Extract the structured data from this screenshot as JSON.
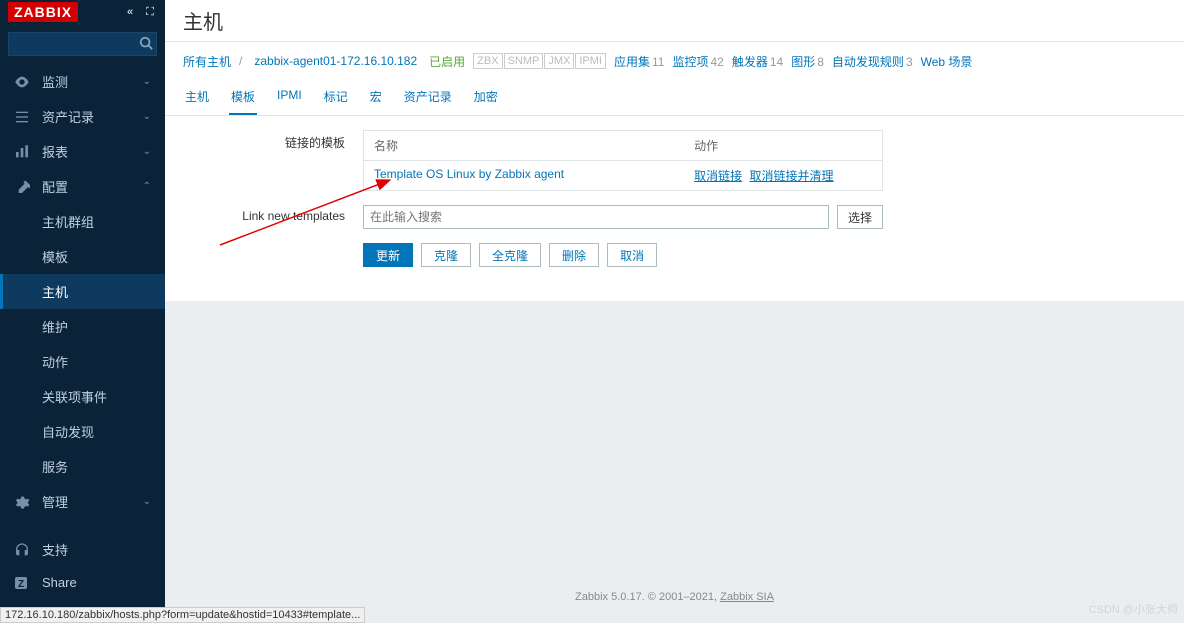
{
  "logo": "ZABBIX",
  "search": {
    "placeholder": ""
  },
  "nav": {
    "monitoring": "监测",
    "inventory": "资产记录",
    "reports": "报表",
    "configuration": "配置",
    "administration": "管理",
    "support": "支持",
    "share": "Share"
  },
  "subnav": {
    "hostGroups": "主机群组",
    "templates": "模板",
    "hosts": "主机",
    "maintenance": "维护",
    "actions": "动作",
    "eventCorrelation": "关联项事件",
    "discovery": "自动发现",
    "services": "服务"
  },
  "pageTitle": "主机",
  "breadcrumb": {
    "allHosts": "所有主机",
    "hostName": "zabbix-agent01-172.16.10.182",
    "enabled": "已启用",
    "zbx": "ZBX",
    "snmp": "SNMP",
    "jmx": "JMX",
    "ipmi": "IPMI",
    "applications": "应用集",
    "applicationsCount": "11",
    "items": "监控项",
    "itemsCount": "42",
    "triggers": "触发器",
    "triggersCount": "14",
    "graphs": "图形",
    "graphsCount": "8",
    "discovery": "自动发现规则",
    "discoveryCount": "3",
    "web": "Web 场景"
  },
  "tabs": {
    "host": "主机",
    "templates": "模板",
    "ipmi": "IPMI",
    "tags": "标记",
    "macros": "宏",
    "inventory": "资产记录",
    "encryption": "加密"
  },
  "form": {
    "linkedTemplatesLabel": "链接的模板",
    "nameHeader": "名称",
    "actionHeader": "动作",
    "templateName": "Template OS Linux by Zabbix agent",
    "unlink": "取消链接",
    "unlinkClear": "取消链接并清理",
    "linkNewLabel": "Link new templates",
    "inputPlaceholder": "在此输入搜索",
    "selectBtn": "选择"
  },
  "buttons": {
    "update": "更新",
    "clone": "克隆",
    "fullClone": "全克隆",
    "delete": "删除",
    "cancel": "取消"
  },
  "footer": {
    "text": "Zabbix 5.0.17. © 2001–2021, ",
    "link": "Zabbix SIA"
  },
  "watermark": "CSDN @小张大师",
  "statusBar": "172.16.10.180/zabbix/hosts.php?form=update&hostid=10433#template..."
}
